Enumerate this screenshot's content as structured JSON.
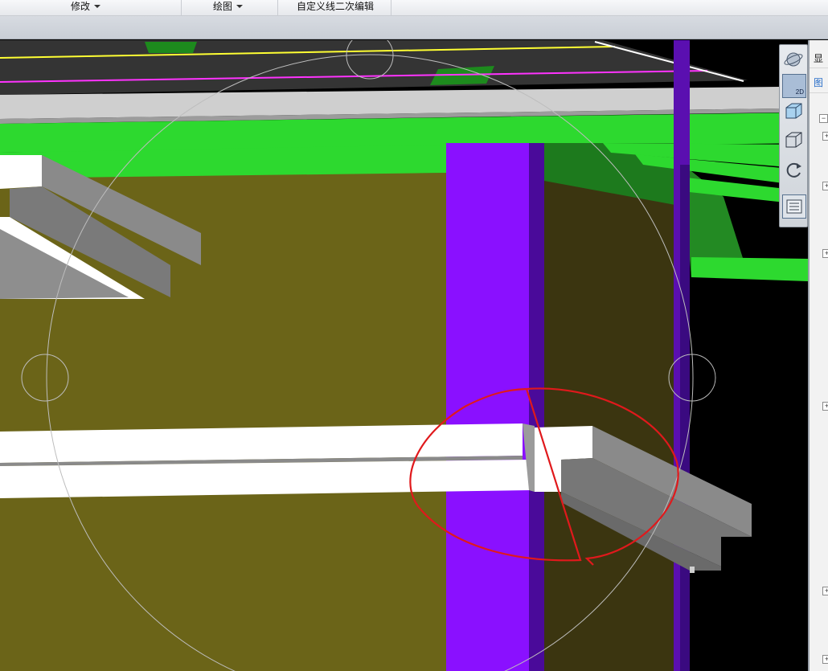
{
  "menubar": {
    "items": [
      {
        "label": "修改",
        "has_dropdown": true
      },
      {
        "label": "绘图",
        "has_dropdown": true
      },
      {
        "label": "自定义线二次编辑",
        "has_dropdown": false
      }
    ]
  },
  "viewcube": {
    "buttons": [
      {
        "name": "orbit",
        "icon": "globe-orbit-icon"
      },
      {
        "name": "2d",
        "icon": "2d-view-icon",
        "label": "2D"
      },
      {
        "name": "3d-solid",
        "icon": "cube-solid-icon"
      },
      {
        "name": "3d-wire",
        "icon": "cube-wireframe-icon"
      },
      {
        "name": "rotate",
        "icon": "rotate-icon"
      },
      {
        "name": "layers",
        "icon": "layer-list-icon"
      }
    ]
  },
  "right_panel": {
    "tab_display": "显",
    "tab_layer": "图",
    "collapse_symbol": "−",
    "expand_symbol": "+"
  },
  "colors": {
    "wall": "#6b6418",
    "slab_green": "#2dd92f",
    "column_purple": "#8a10ff",
    "beam_white": "#ffffff",
    "beam_gray": "#8a8a8a",
    "annotation_red": "#e0191c"
  }
}
